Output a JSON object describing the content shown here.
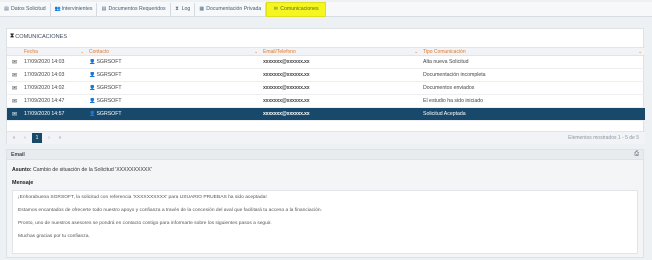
{
  "tabs": [
    {
      "label": "Datos Solicitud",
      "icon": "document-icon",
      "glyph": "▤",
      "active": false
    },
    {
      "label": "Intervinientes",
      "icon": "users-icon",
      "glyph": "👥",
      "active": false
    },
    {
      "label": "Documentos Requeridos",
      "icon": "documents-icon",
      "glyph": "▤",
      "active": false
    },
    {
      "label": "Log",
      "icon": "hourglass-icon",
      "glyph": "⧗",
      "active": false
    },
    {
      "label": "Documentación Privada",
      "icon": "folder-icon",
      "glyph": "▦",
      "active": false
    },
    {
      "label": "Comunicaciones",
      "icon": "envelope-icon",
      "glyph": "✉",
      "active": true
    }
  ],
  "panel": {
    "title": "COMUNICACIONES",
    "columns": [
      "Fecha",
      "Contacto",
      "Email/Telefono",
      "Tipo Comunicación"
    ]
  },
  "rows": [
    {
      "fecha": "17/09/2020 14:03",
      "contacto": "SGRSOFT",
      "email": "xxxxxxx@xxxxxx.xx",
      "tipo": "Alta nueva Solicitud",
      "selected": false
    },
    {
      "fecha": "17/09/2020 14:03",
      "contacto": "SGRSOFT",
      "email": "xxxxxxx@xxxxxx.xx",
      "tipo": "Documentación incompleta",
      "selected": false
    },
    {
      "fecha": "17/09/2020 14:02",
      "contacto": "SGRSOFT",
      "email": "xxxxxxx@xxxxxx.xx",
      "tipo": "Documentos enviados",
      "selected": false
    },
    {
      "fecha": "17/09/2020 14:47",
      "contacto": "SGRSOFT",
      "email": "xxxxxxx@xxxxxx.xx",
      "tipo": "El estudio ha sido iniciado",
      "selected": false
    },
    {
      "fecha": "17/09/2020 14:57",
      "contacto": "SGRSOFT",
      "email": "xxxxxxx@xxxxxx.xx",
      "tipo": "Solicitud Aceptada",
      "selected": true
    }
  ],
  "pager": {
    "first": "«",
    "prev": "‹",
    "current": "1",
    "next": "›",
    "last": "»",
    "info": "Elementos mostrados 1 - 5 de 5"
  },
  "email": {
    "header": "Email",
    "asunto_label": "Asunto:",
    "asunto_text": "Cambio de situación de la Solicitud 'XXXXXXXXXX'",
    "mensaje_label": "Mensaje",
    "paragraphs": [
      "¡Enhorabuena SGRSOFT, la solicitud con referencia 'XXXXXXXXXX' para USUARIO PRUEBAS ha sido aceptada!",
      "Estamos encantados de ofrecerte todo nuestro apoyo y confianza a través de la concesión del aval que facilitará tu acceso a la financiación.",
      "Pronto, uno de nuestros asesores se pondrá en contacto contigo para informarte sobre los siguientes pasos a seguir.",
      "Muchas gracias por tu confianza."
    ]
  }
}
